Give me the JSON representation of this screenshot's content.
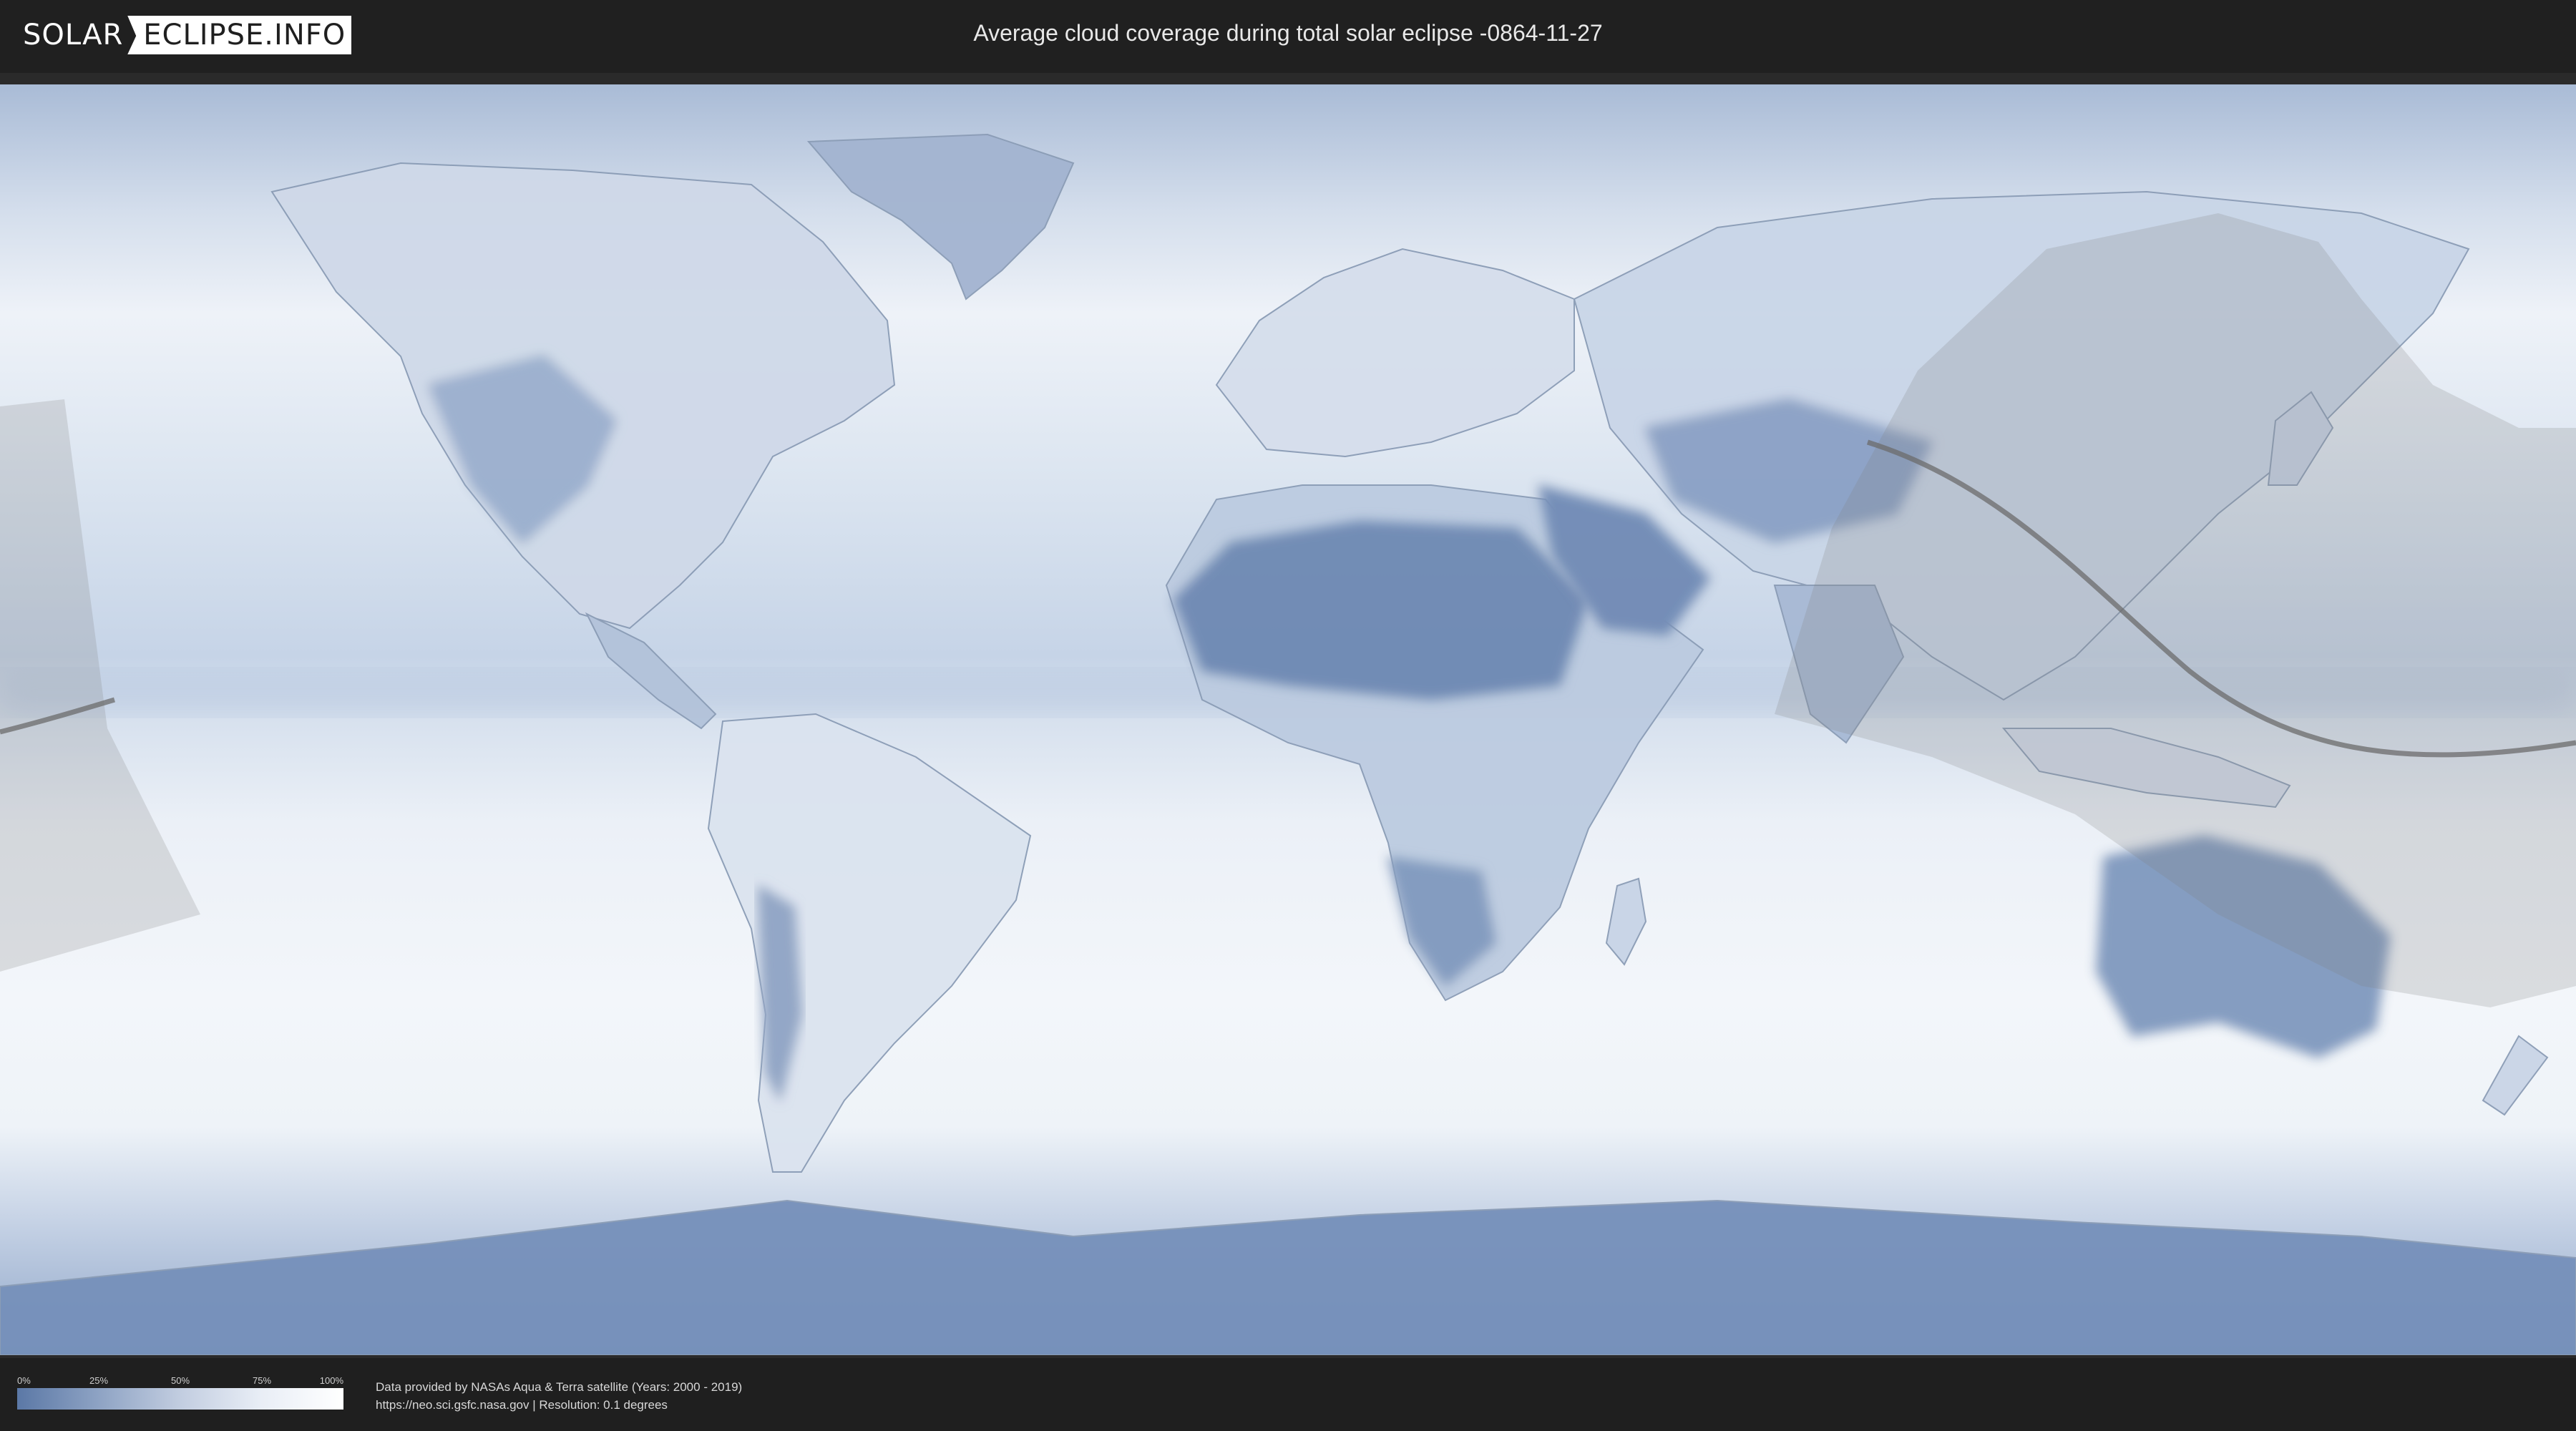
{
  "header": {
    "logo_left": "SOLAR",
    "logo_right": "ECLIPSE.INFO",
    "title": "Average cloud coverage during total solar eclipse -0864-11-27"
  },
  "legend": {
    "ticks": [
      "0%",
      "25%",
      "50%",
      "75%",
      "100%"
    ],
    "colors": [
      "#5b78a6",
      "#8ea3c4",
      "#c2cde0",
      "#e9eef6",
      "#ffffff"
    ]
  },
  "credits": {
    "line1": "Data provided by NASAs Aqua & Terra satellite (Years: 2000 - 2019)",
    "line2": "https://neo.sci.gsfc.nasa.gov | Resolution: 0.1 degrees"
  },
  "map": {
    "projection": "equirectangular",
    "ocean_color": "#dfe7f2",
    "cloud_colors": {
      "clear": "#6a86b2",
      "cloudy": "#f4f7fb"
    },
    "shadow_color": "#808080",
    "path_color": "#6b6b6b"
  }
}
